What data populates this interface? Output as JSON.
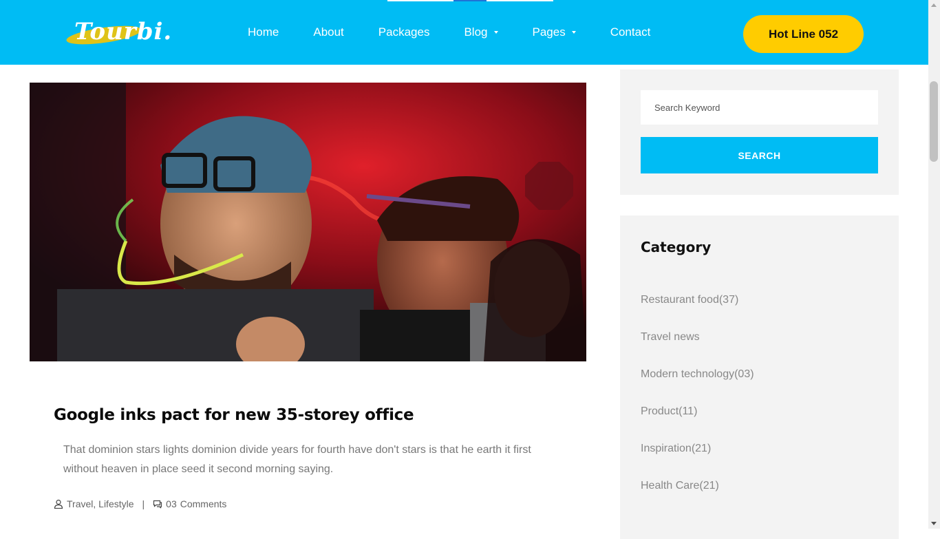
{
  "brand": {
    "logo_text": "Tourbi.",
    "accent_color": "#00bcf4",
    "hotline_color": "#ffcc00"
  },
  "nav": {
    "items": [
      {
        "label": "Home",
        "has_dropdown": false
      },
      {
        "label": "About",
        "has_dropdown": false
      },
      {
        "label": "Packages",
        "has_dropdown": false
      },
      {
        "label": "Blog",
        "has_dropdown": true
      },
      {
        "label": "Pages",
        "has_dropdown": true
      },
      {
        "label": "Contact",
        "has_dropdown": false
      }
    ],
    "hotline_label": "Hot Line 052"
  },
  "post": {
    "image_icon": "photo-party-people",
    "title": "Google inks pact for new 35-storey office",
    "excerpt": "That dominion stars lights dominion divide years for fourth have don't stars is that he earth it first without heaven in place seed it second morning saying.",
    "categories": "Travel, Lifestyle",
    "separator": "|",
    "comments_count": "03",
    "comments_label": "Comments"
  },
  "sidebar": {
    "search": {
      "placeholder": "Search Keyword",
      "button_label": "SEARCH"
    },
    "category": {
      "title": "Category",
      "items": [
        {
          "label": "Restaurant food(37)"
        },
        {
          "label": "Travel news"
        },
        {
          "label": "Modern technology(03)"
        },
        {
          "label": "Product(11)"
        },
        {
          "label": "Inspiration(21)"
        },
        {
          "label": "Health Care(21)"
        }
      ]
    }
  }
}
